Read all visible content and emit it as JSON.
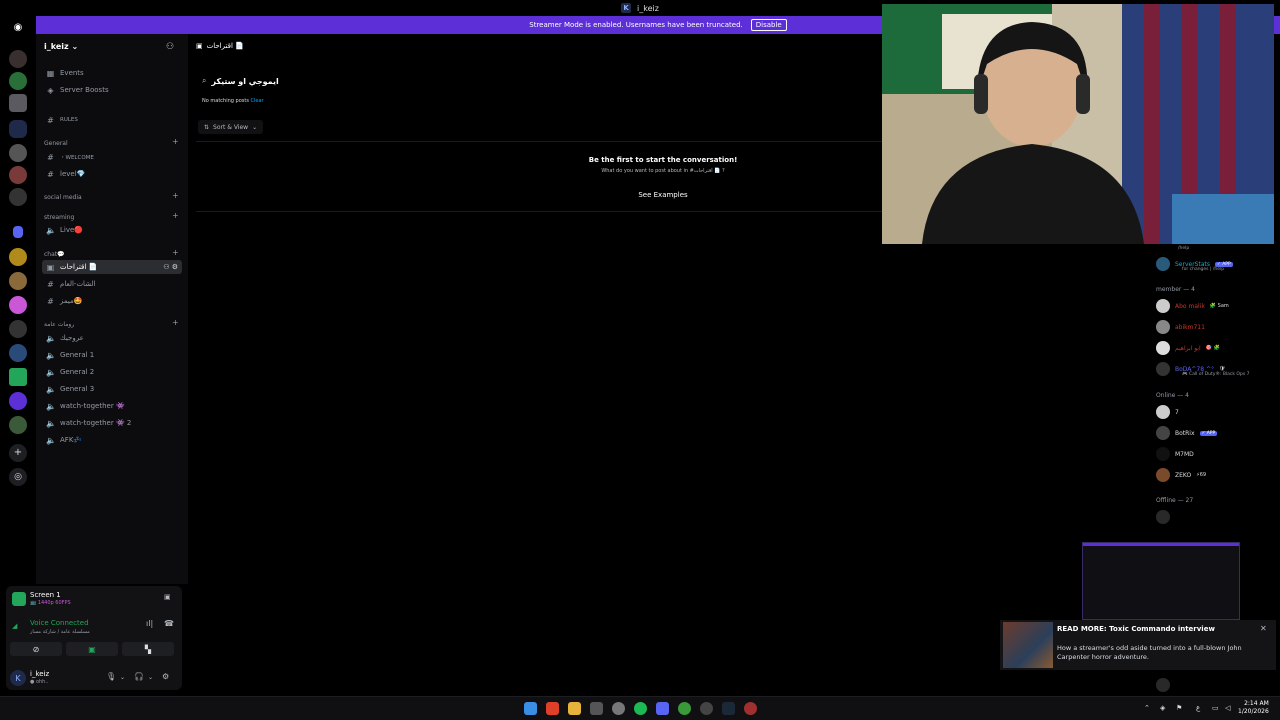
{
  "window": {
    "title": "i_keiz"
  },
  "banner": {
    "text": "Streamer Mode is enabled. Usernames have been truncated.",
    "disable_label": "Disable"
  },
  "guild": {
    "name": "i_keiz ⌄"
  },
  "sidebar": {
    "top_items": [
      {
        "label": "Events"
      },
      {
        "label": "Server Boosts"
      }
    ],
    "rules": "RULES",
    "categories": {
      "general": "General",
      "social": "social media",
      "streaming": "streaming",
      "chat": "chat💬",
      "voice": "رومات عامة"
    },
    "channels": {
      "welcome": "・WELCOME",
      "level": "level💎",
      "live": "Live🔴",
      "suggestions": "اقتراحات 📄",
      "general_chat": "الشات-العام",
      "memes": "ميمز🤩",
      "voice_1": "عروجيك",
      "voice_2": "General 1",
      "voice_3": "General 2",
      "voice_4": "General 3",
      "voice_5": "watch-together 👾",
      "voice_6": "watch-together 👾 2",
      "voice_7": "AFK💤"
    }
  },
  "panel": {
    "screen_title": "Screen 1",
    "screen_sub": "📺 1440p 60FPS",
    "voice_status": "Voice Connected",
    "voice_sub": "مسلسلة عامة / شاركة مسار",
    "user_name": "i_keiz",
    "user_status": "● ohh.."
  },
  "main": {
    "channel_title": "اقتراحات 📄",
    "search_value": "ايموجي او ستيكر",
    "no_match": "No matching posts",
    "clear": "Clear",
    "sort_view": "Sort & View",
    "empty_title": "Be the first to start the conversation!",
    "empty_sub": "What do you want to post about in #اقتراحات 📄 ?",
    "see_examples": "See Examples"
  },
  "members": {
    "serverstats": {
      "name": "ServerStats",
      "badge": "✓ APP",
      "sub": "for changes | /help",
      "help": "/help"
    },
    "cat_member": "member — 4",
    "member_list": [
      {
        "name": "Abo malik",
        "extra": "🧩 Sam"
      },
      {
        "name": "abikm711",
        "extra": ""
      },
      {
        "name": "ابو ابراهيم",
        "extra": "🎯 🧩"
      },
      {
        "name": "BoDA^78 ^°",
        "extra": "🛡",
        "sub": "🎮 Call of Duty®: Black Ops 7"
      }
    ],
    "cat_online": "Online — 4",
    "online_list": [
      {
        "name": "7",
        "badge": ""
      },
      {
        "name": "BotRix",
        "badge": "✓ APP"
      },
      {
        "name": "M7MD",
        "badge": ""
      },
      {
        "name": "ZEKO",
        "badge": "⚡69"
      }
    ],
    "cat_offline": "Offline — 27"
  },
  "toast": {
    "title": "READ MORE: Toxic Commando interview",
    "body": "How a streamer's odd aside turned into a full-blown John Carpenter horror adventure."
  },
  "taskbar": {
    "time": "2:14 AM",
    "date": "1/20/2026",
    "lang": "ع"
  },
  "colors": {
    "accent": "#5865f2",
    "banner": "#5c30d6",
    "online": "#23a55a",
    "link": "#00a8fc"
  }
}
